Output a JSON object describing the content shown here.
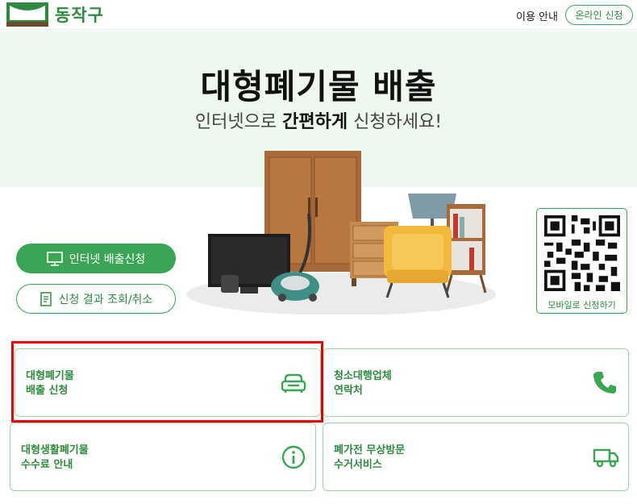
{
  "header": {
    "logo_text": "동작구",
    "nav_guide": "이용 안내",
    "nav_apply": "온라인 신청"
  },
  "hero": {
    "title": "대형폐기물 배출",
    "subtitle_pre": "인터넷으로 ",
    "subtitle_bold": "간편하게",
    "subtitle_post": " 신청하세요!"
  },
  "buttons": {
    "internet_apply": "인터넷 배출신청",
    "result_lookup": "신청 결과 조회/취소"
  },
  "qr": {
    "label": "모바일로 신청하기"
  },
  "cards": [
    {
      "line1": "대형폐기물",
      "line2": "배출 신청",
      "icon": "sofa-icon"
    },
    {
      "line1": "청소대행업체",
      "line2": "연락처",
      "icon": "phone-icon"
    },
    {
      "line1": "대형생활폐기물",
      "line2": "수수료 안내",
      "icon": "info-icon"
    },
    {
      "line1": "폐가전 무상방문",
      "line2": "수거서비스",
      "icon": "truck-icon"
    }
  ],
  "colors": {
    "brand_green": "#3aa655",
    "text_green": "#2d8a3e",
    "hero_bg": "#eff8ef",
    "highlight": "#ee0000"
  }
}
